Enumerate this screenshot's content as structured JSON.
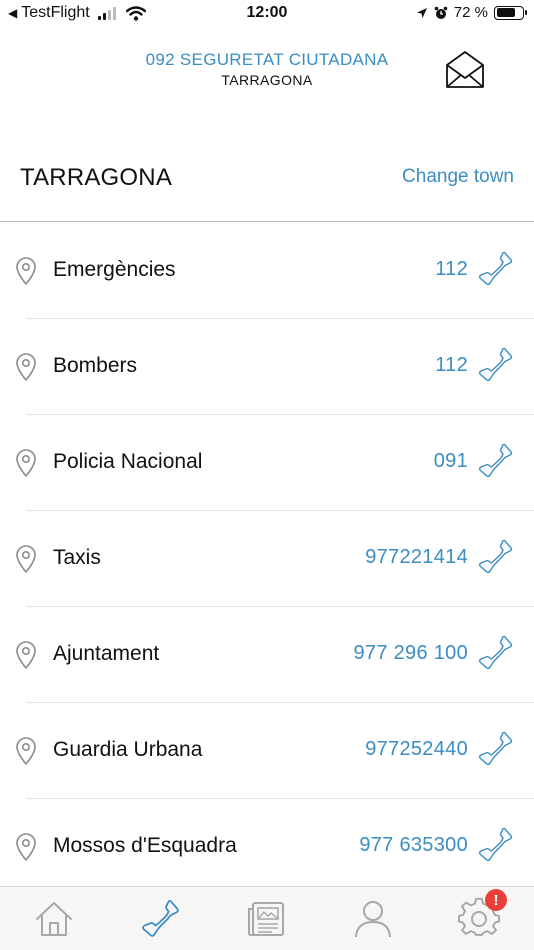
{
  "status_bar": {
    "back_app": "TestFlight",
    "time": "12:00",
    "battery_text": "72 %",
    "battery_level": 0.72
  },
  "header": {
    "title": "092 SEGURETAT CIUTADANA",
    "subtitle": "TARRAGONA",
    "mail_icon": "envelope-open-icon"
  },
  "town_bar": {
    "town": "TARRAGONA",
    "change_label": "Change town"
  },
  "contacts": [
    {
      "label": "Emergències",
      "number": "112"
    },
    {
      "label": "Bombers",
      "number": "112"
    },
    {
      "label": "Policia Nacional",
      "number": "091"
    },
    {
      "label": "Taxis",
      "number": "977221414"
    },
    {
      "label": "Ajuntament",
      "number": "977 296 100"
    },
    {
      "label": "Guardia Urbana",
      "number": "977252440"
    },
    {
      "label": "Mossos d'Esquadra",
      "number": "977 635300"
    }
  ],
  "tab_bar": {
    "tabs": [
      "home-icon",
      "phone-icon",
      "news-icon",
      "profile-icon",
      "settings-icon"
    ],
    "active_tab": "phone-icon",
    "settings_badge": "!"
  },
  "colors": {
    "accent": "#3b8dc3",
    "badge": "#e8413a",
    "tab_inactive": "#a8a8a8"
  }
}
